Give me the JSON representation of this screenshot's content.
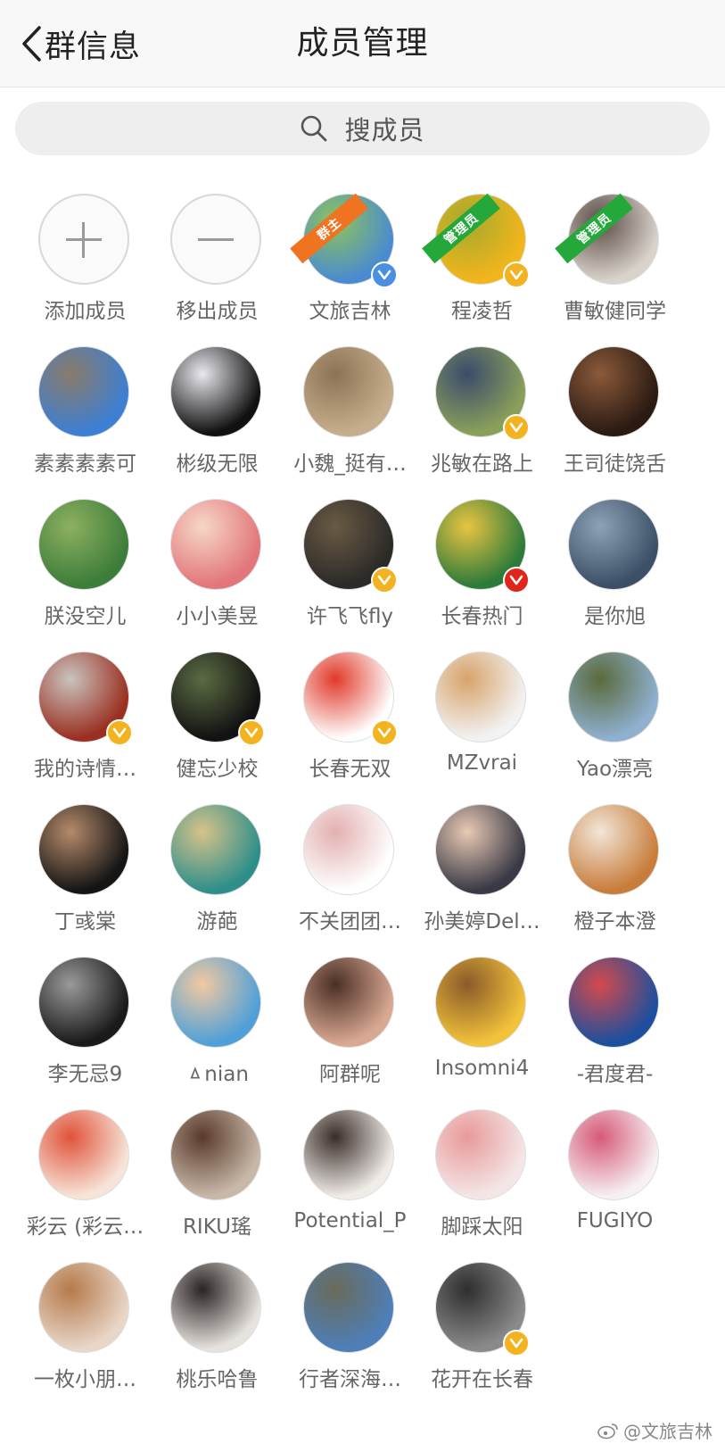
{
  "header": {
    "back_label": "群信息",
    "title": "成员管理"
  },
  "search": {
    "placeholder": "搜成员"
  },
  "actions": [
    {
      "label": "添加成员",
      "icon": "plus-icon"
    },
    {
      "label": "移出成员",
      "icon": "minus-icon"
    }
  ],
  "members": [
    {
      "name": "文旅吉林",
      "role": "群主",
      "badge": "blue",
      "colors": [
        "#4a8bd0",
        "#8fc45a"
      ]
    },
    {
      "name": "程凌哲",
      "role": "管理员",
      "badge": "gold",
      "colors": [
        "#f2b51c",
        "#a5a92d"
      ]
    },
    {
      "name": "曹敏健同学",
      "role": "管理员",
      "badge": "",
      "colors": [
        "#d9d3cc",
        "#5a4a44"
      ]
    },
    {
      "name": "素素素素可",
      "role": "",
      "badge": "",
      "colors": [
        "#3d7fd3",
        "#8a7b6a"
      ]
    },
    {
      "name": "彬级无限",
      "role": "",
      "badge": "",
      "colors": [
        "#111111",
        "#e8e8ee"
      ]
    },
    {
      "name": "小魏_挺有…",
      "role": "",
      "badge": "",
      "colors": [
        "#c6ad8b",
        "#8c7356"
      ]
    },
    {
      "name": "兆敏在路上",
      "role": "",
      "badge": "gold",
      "colors": [
        "#8aa05a",
        "#3b4b6c"
      ]
    },
    {
      "name": "王司徒饶舌",
      "role": "",
      "badge": "",
      "colors": [
        "#2a1a12",
        "#8b5a3a"
      ]
    },
    {
      "name": "朕没空儿",
      "role": "",
      "badge": "",
      "colors": [
        "#3d7d3a",
        "#8db060"
      ]
    },
    {
      "name": "小小美昱",
      "role": "",
      "badge": "",
      "colors": [
        "#e2767a",
        "#f6d7c7"
      ]
    },
    {
      "name": "许飞飞fly",
      "role": "",
      "badge": "gold",
      "colors": [
        "#2b2a28",
        "#6a5a44"
      ]
    },
    {
      "name": "长春热门",
      "role": "",
      "badge": "red",
      "colors": [
        "#2d7a3a",
        "#e9c442"
      ]
    },
    {
      "name": "是你旭",
      "role": "",
      "badge": "",
      "colors": [
        "#3b4f66",
        "#8ea2b6"
      ]
    },
    {
      "name": "我的诗情…",
      "role": "",
      "badge": "gold",
      "colors": [
        "#9b2f22",
        "#c9c4be"
      ]
    },
    {
      "name": "健忘少校",
      "role": "",
      "badge": "gold",
      "colors": [
        "#121212",
        "#5b6b43"
      ]
    },
    {
      "name": "长春无双",
      "role": "",
      "badge": "gold",
      "colors": [
        "#ffffff",
        "#e03a2a"
      ]
    },
    {
      "name": "MZvrai",
      "role": "",
      "badge": "",
      "colors": [
        "#f2f2f2",
        "#d8a36a"
      ]
    },
    {
      "name": "Yao漂亮",
      "role": "",
      "badge": "",
      "colors": [
        "#8fb0cf",
        "#5a6a3b"
      ]
    },
    {
      "name": "丁彧棠",
      "role": "",
      "badge": "",
      "colors": [
        "#151515",
        "#b58a6a"
      ]
    },
    {
      "name": "游葩",
      "role": "",
      "badge": "",
      "colors": [
        "#2e8f8a",
        "#d7c28a"
      ]
    },
    {
      "name": "不关团团…",
      "role": "",
      "badge": "",
      "colors": [
        "#ffffff",
        "#e3b0b0"
      ]
    },
    {
      "name": "孙美婷Del…",
      "role": "",
      "badge": "",
      "colors": [
        "#3a3a46",
        "#e8c9b4"
      ]
    },
    {
      "name": "橙子本澄",
      "role": "",
      "badge": "",
      "colors": [
        "#c87d3b",
        "#f2e6d8"
      ]
    },
    {
      "name": "李无忌9",
      "role": "",
      "badge": "",
      "colors": [
        "#1a1a1a",
        "#9a9a9a"
      ]
    },
    {
      "name": "ㅿnian",
      "role": "",
      "badge": "",
      "colors": [
        "#4fa0d8",
        "#f1c9a0"
      ]
    },
    {
      "name": "阿群呢",
      "role": "",
      "badge": "",
      "colors": [
        "#d9a892",
        "#4a2f25"
      ]
    },
    {
      "name": "Insomni4",
      "role": "",
      "badge": "",
      "colors": [
        "#f2c23a",
        "#8a5a2a"
      ]
    },
    {
      "name": "-君度君-",
      "role": "",
      "badge": "",
      "colors": [
        "#1d4f9e",
        "#d44a4a"
      ]
    },
    {
      "name": "彩云 (彩云…",
      "role": "",
      "badge": "",
      "colors": [
        "#f6e4d8",
        "#e0533a"
      ]
    },
    {
      "name": "RIKU瑤",
      "role": "",
      "badge": "",
      "colors": [
        "#c8b8a8",
        "#5a3a2a"
      ]
    },
    {
      "name": "Potential_P",
      "role": "",
      "badge": "",
      "colors": [
        "#f0ece8",
        "#3a2e2a"
      ]
    },
    {
      "name": "脚踩太阳",
      "role": "",
      "badge": "",
      "colors": [
        "#f4e6e6",
        "#e89a9a"
      ]
    },
    {
      "name": "FUGIYO",
      "role": "",
      "badge": "",
      "colors": [
        "#f6f0f2",
        "#d65a78"
      ]
    },
    {
      "name": "一枚小朋…",
      "role": "",
      "badge": "",
      "colors": [
        "#e8d6c8",
        "#b57a4a"
      ]
    },
    {
      "name": "桃乐哈鲁",
      "role": "",
      "badge": "",
      "colors": [
        "#e6e2de",
        "#2a2422"
      ]
    },
    {
      "name": "行者深海…",
      "role": "",
      "badge": "",
      "colors": [
        "#4e7fb8",
        "#6a6a5a"
      ]
    },
    {
      "name": "花开在长春",
      "role": "",
      "badge": "gold",
      "colors": [
        "#8a8a8a",
        "#2e2e2e"
      ]
    }
  ],
  "watermark": "@文旅吉林"
}
